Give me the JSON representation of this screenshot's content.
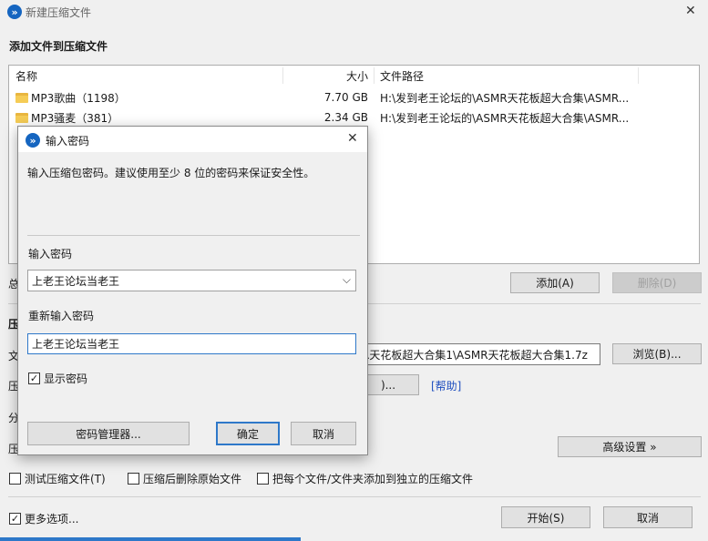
{
  "window": {
    "title": "新建压缩文件",
    "close_glyph": "✕",
    "app_glyph": "»"
  },
  "section_title": "添加文件到压缩文件",
  "file_list": {
    "columns": {
      "name": "名称",
      "size": "大小",
      "path": "文件路径"
    },
    "rows": [
      {
        "name": "MP3歌曲（1198）",
        "size": "7.70 GB",
        "path": "H:\\发到老王论坛的\\ASMR天花板超大合集\\ASMR..."
      },
      {
        "name": "MP3骚麦（381）",
        "size": "2.34 GB",
        "path": "H:\\发到老王论坛的\\ASMR天花板超大合集\\ASMR..."
      }
    ]
  },
  "buttons": {
    "add": "添加(A)",
    "delete": "删除(D)",
    "browse": "浏览(B)...",
    "more_dots": ")...",
    "help": "[帮助]",
    "advanced": "高级设置 »",
    "start": "开始(S)",
    "cancel": "取消"
  },
  "left_labels": {
    "total": "总",
    "compress_header": "压",
    "file": "文",
    "compress_row": "压",
    "split": "分",
    "compress_row2": "压"
  },
  "archive_path_value": "R天花板超大合集1\\ASMR天花板超大合集1.7z",
  "options": {
    "test": {
      "label": "测试压缩文件(T)",
      "checked": false
    },
    "delete_after": {
      "label": "压缩后删除原始文件",
      "checked": false
    },
    "separate": {
      "label": "把每个文件/文件夹添加到独立的压缩文件",
      "checked": false
    },
    "more": {
      "label": "更多选项...",
      "checked": true
    }
  },
  "dialog": {
    "title": "输入密码",
    "description": "输入压缩包密码。建议使用至少 8 位的密码来保证安全性。",
    "password_label": "输入密码",
    "password_value": "上老王论坛当老王",
    "confirm_label": "重新输入密码",
    "confirm_value": "上老王论坛当老王",
    "show_password": {
      "label": "显示密码",
      "checked": true
    },
    "manager_button": "密码管理器...",
    "ok_button": "确定",
    "cancel_button": "取消",
    "dropdown_glyph": "⌵"
  },
  "check_glyph": "✓"
}
